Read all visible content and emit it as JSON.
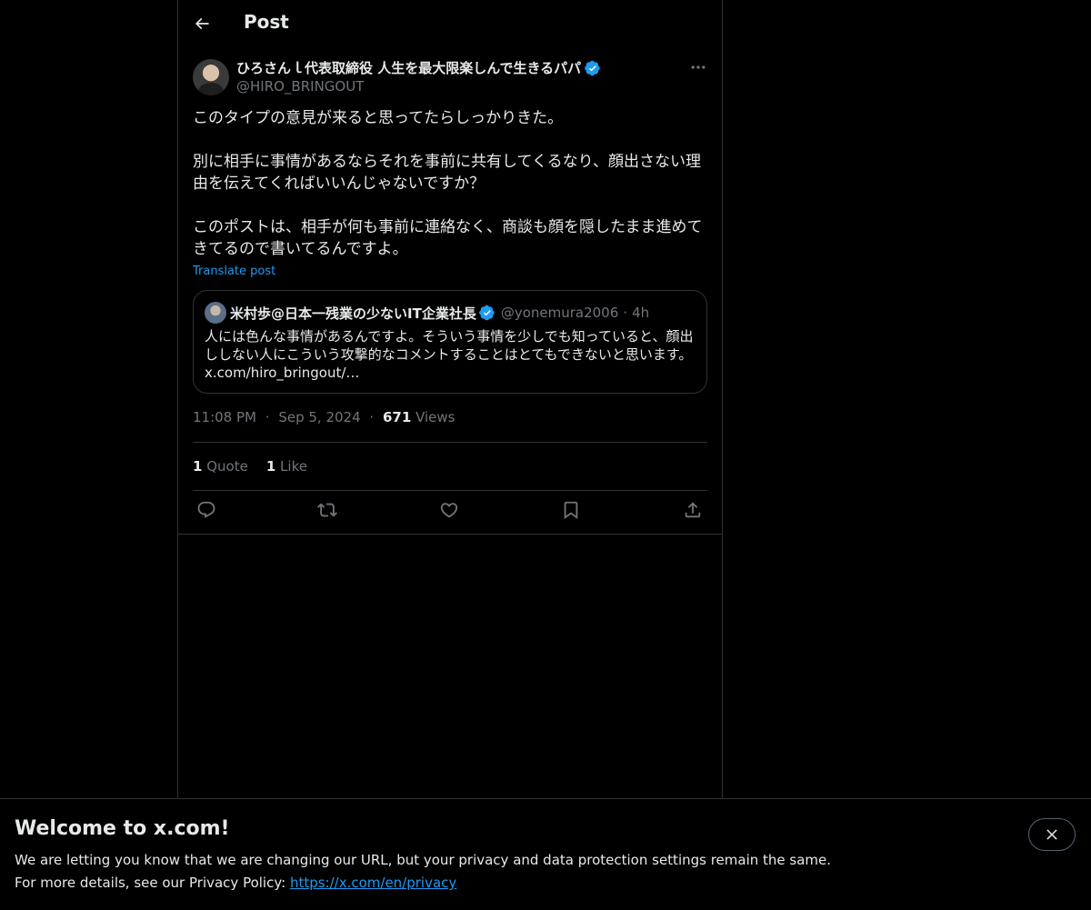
{
  "header": {
    "title": "Post"
  },
  "post": {
    "author": {
      "name": "ひろさんｌ代表取締役 人生を最大限楽しんで生きるパパ",
      "handle": "@HIRO_BRINGOUT"
    },
    "text_lines": [
      "このタイプの意見が来ると思ってたらしっかりきた。",
      "",
      "別に相手に事情があるならそれを事前に共有してくるなり、顔出さない理",
      "由を伝えてくればいいんじゃないですか？",
      "",
      "このポストは、相手が何も事前に連絡なく、商談も顔を隠したまま進めて",
      "きてるので書いてるんですよ。"
    ],
    "translate_label": "Translate post",
    "quote": {
      "name": "米村歩@日本一残業の少ないIT企業社長",
      "handle": "@yonemura2006",
      "separator": "·",
      "time": "4h",
      "text_lines": [
        "人には色んな事情があるんですよ。そういう事情を少しでも知っていると、顔出",
        "ししない人にこういう攻撃的なコメントすることはとてもできないと思います。",
        "x.com/hiro_bringout/…"
      ]
    },
    "meta": {
      "time": "11:08 PM",
      "separator": "·",
      "date": "Sep 5, 2024",
      "views_count": "671",
      "views_label": "Views"
    },
    "stats": {
      "quote_count": "1",
      "quote_label": "Quote",
      "like_count": "1",
      "like_label": "Like"
    }
  },
  "banner": {
    "title": "Welcome to x.com!",
    "line1": "We are letting you know that we are changing our URL, but your privacy and data protection settings remain the same.",
    "line2_prefix": "For more details, see our Privacy Policy: ",
    "link": "https://x.com/en/privacy"
  },
  "colors": {
    "background": "#000000",
    "text": "#e7e9ea",
    "muted": "#71767b",
    "accent": "#1d9bf0",
    "border": "#2f3336"
  },
  "icons": {
    "back": "arrow-left-icon",
    "more": "more-horizontal-icon",
    "verified": "verified-badge-icon",
    "reply": "reply-icon",
    "repost": "repost-icon",
    "like": "heart-icon",
    "bookmark": "bookmark-icon",
    "share": "share-icon",
    "close": "close-icon"
  }
}
